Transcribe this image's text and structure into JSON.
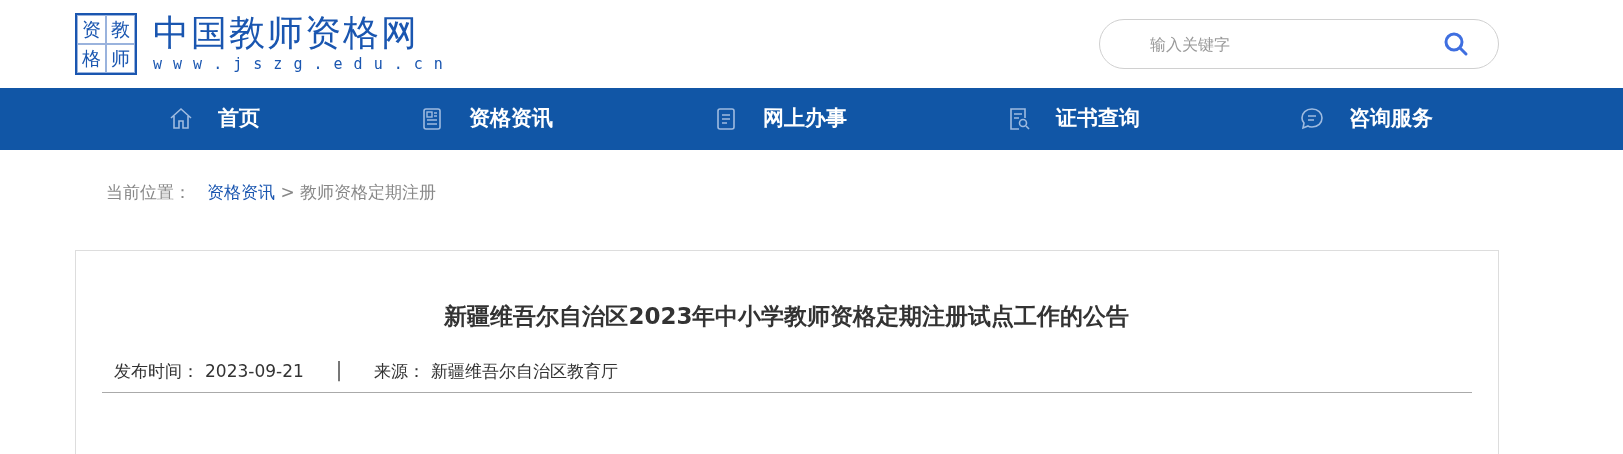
{
  "logo": {
    "seal_chars": [
      "资",
      "教",
      "格",
      "师"
    ],
    "title": "中国教师资格网",
    "url": "w w w . j s z g . e d u . c n"
  },
  "search": {
    "placeholder": "输入关键字"
  },
  "nav": [
    {
      "label": "首页"
    },
    {
      "label": "资格资讯"
    },
    {
      "label": "网上办事"
    },
    {
      "label": "证书查询"
    },
    {
      "label": "咨询服务"
    }
  ],
  "breadcrumb": {
    "prefix": "当前位置：",
    "link": "资格资讯",
    "separator": ">",
    "current": "教师资格定期注册"
  },
  "article": {
    "title": "新疆维吾尔自治区2023年中小学教师资格定期注册试点工作的公告",
    "date_label": "发布时间：",
    "date": "2023-09-21",
    "divider": "│",
    "source_label": "来源：",
    "source": "新疆维吾尔自治区教育厅"
  }
}
